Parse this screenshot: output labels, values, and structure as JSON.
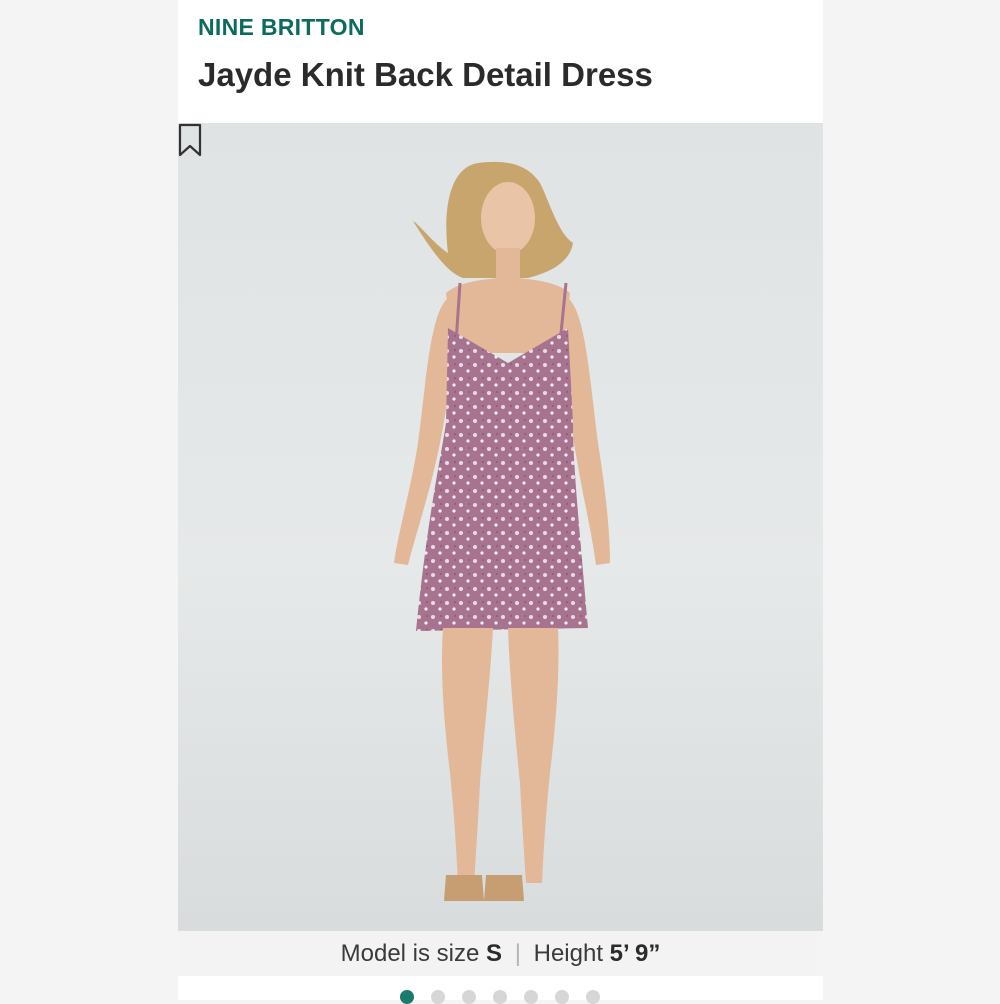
{
  "product": {
    "brand": "NINE BRITTON",
    "title": "Jayde Knit Back Detail Dress"
  },
  "image": {
    "bookmark_icon": "bookmark-icon",
    "caption": {
      "model_label": "Model is size",
      "size": "S",
      "separator": "|",
      "height_label": "Height",
      "height": "5’ 9”"
    }
  },
  "carousel": {
    "total": 7,
    "active_index": 0,
    "active_color": "#1a7a6c"
  },
  "colors": {
    "brand": "#0d6b5e",
    "dress": "#a7738f"
  }
}
